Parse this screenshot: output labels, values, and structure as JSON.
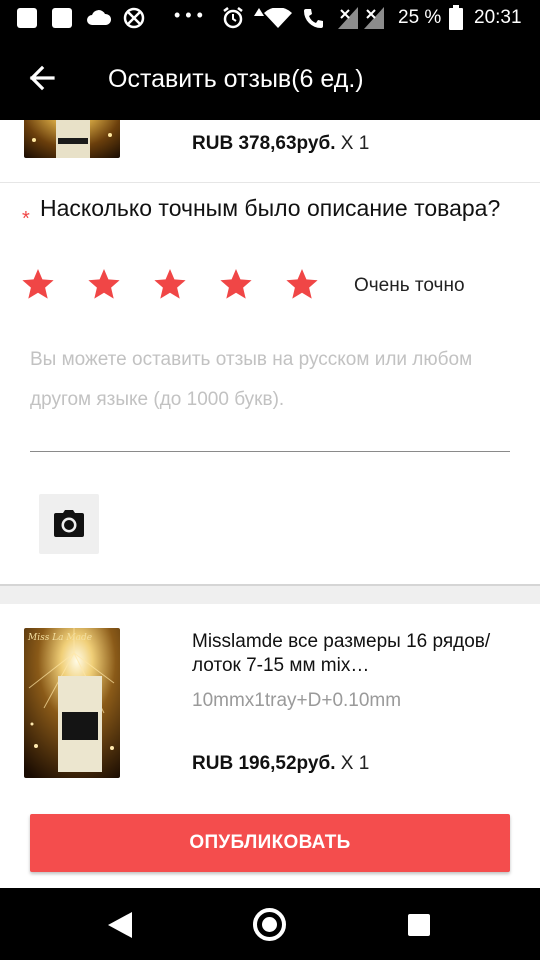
{
  "status_bar": {
    "battery_percent": "25 %",
    "time": "20:31",
    "icons": [
      "notification-square-icon",
      "notification-square-icon",
      "cloud-icon",
      "wifi-off-icon",
      "more-icon",
      "alarm-icon",
      "data-icon",
      "wifi-icon",
      "call-icon",
      "signal-icon",
      "signal-icon",
      "battery-icon"
    ]
  },
  "app_bar": {
    "title": "Оставить отзыв(6 ед.)",
    "back_icon": "arrow-left-icon"
  },
  "item1": {
    "price": "RUB 378,63руб.",
    "qty": "X 1"
  },
  "review": {
    "required_mark": "*",
    "question": "Насколько точным было описание товара?",
    "rating": 5,
    "rating_max": 5,
    "rating_label": "Очень точно",
    "star_color": "#f04646",
    "placeholder": "Вы можете оставить отзыв на русском или любом другом языке (до 1000 букв).",
    "camera_icon": "camera-icon"
  },
  "item2": {
    "title": "Misslamde все размеры 16 рядов/лоток 7-15 мм mix…",
    "variant": "10mmx1tray+D+0.10mm",
    "price": "RUB 196,52руб.",
    "qty": "X 1",
    "thumb_text": "Miss La Made"
  },
  "publish_label": "ОПУБЛИКОВАТЬ",
  "accent_color": "#f44d4d",
  "nav_bar": {
    "icons": [
      "nav-back-icon",
      "nav-home-icon",
      "nav-recents-icon"
    ]
  }
}
